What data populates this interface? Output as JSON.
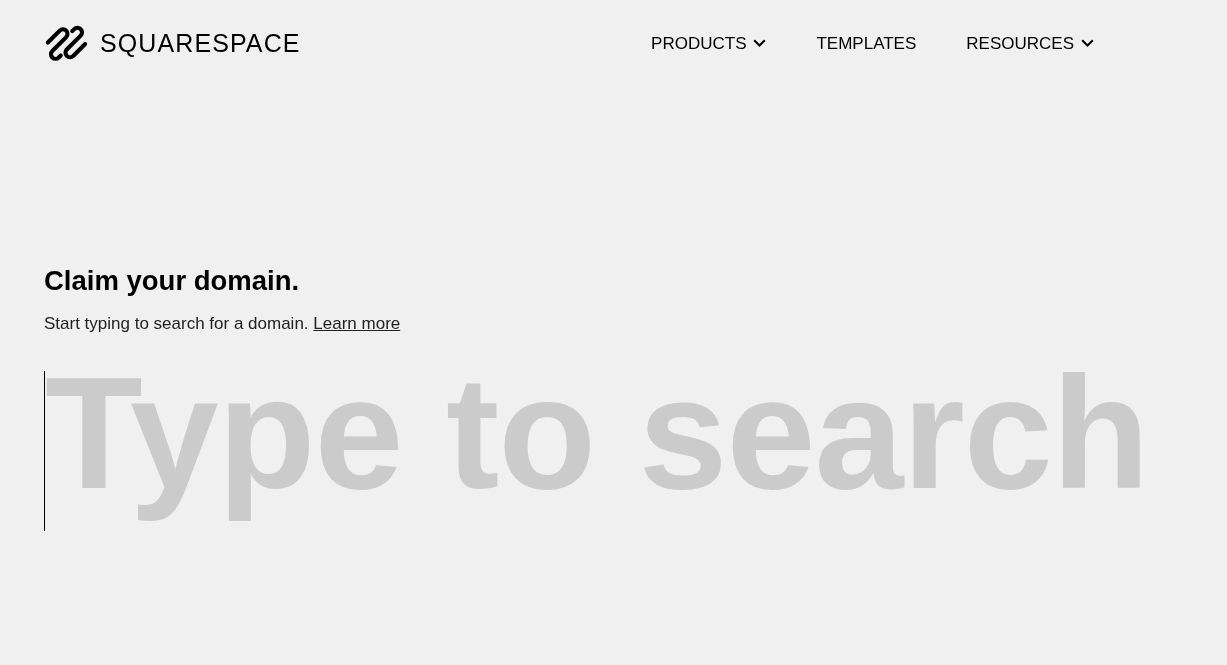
{
  "header": {
    "logo": {
      "text": "SQUARESPACE"
    },
    "nav": [
      {
        "label": "PRODUCTS",
        "has_menu": true
      },
      {
        "label": "TEMPLATES",
        "has_menu": false
      },
      {
        "label": "RESOURCES",
        "has_menu": true
      }
    ]
  },
  "domain_search": {
    "title": "Claim your domain.",
    "description": "Start typing to search for a domain.",
    "link": "Learn more",
    "search": {
      "placeholder": "Type to search"
    }
  }
}
